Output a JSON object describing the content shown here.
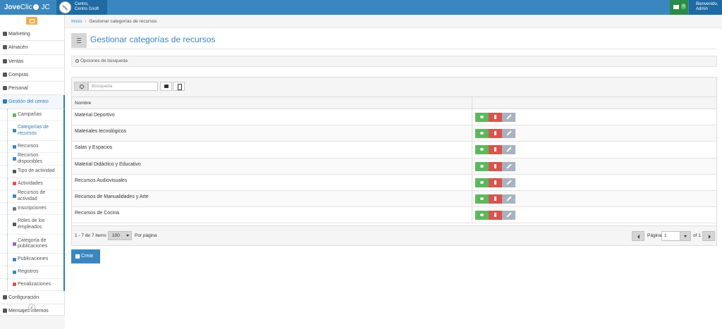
{
  "brand": {
    "logo": "JoveClic",
    "logo_bold": "Jove",
    "logo_light": "Clic",
    "logo_suffix": "JC",
    "color": "#3a87c0"
  },
  "center": {
    "line1": "Centro,",
    "line2": "Centro Gsoft"
  },
  "mail": {
    "badge": "0"
  },
  "user": {
    "line1": "Bienvenido,",
    "line2": "Admin"
  },
  "sidebar": {
    "items_top": [
      {
        "label": "Marketing",
        "icon": "bullhorn-icon"
      },
      {
        "label": "Almacén",
        "icon": "inbox-icon"
      },
      {
        "label": "Ventas",
        "icon": "truck-icon"
      },
      {
        "label": "Compras",
        "icon": "tag-icon"
      },
      {
        "label": "Personal",
        "icon": "graduation-cap-icon"
      },
      {
        "label": "Gestión del centro",
        "icon": "building-icon"
      }
    ],
    "sub_items": [
      {
        "label": "Campañas",
        "icon": "bullhorn-icon",
        "color": "#5cb85c"
      },
      {
        "label": "Categorías de recursos",
        "icon": "tags-icon",
        "color": "#3a87c0"
      },
      {
        "label": "Recursos",
        "icon": "tag-icon",
        "color": "#3a87c0"
      },
      {
        "label": "Recursos disponibles",
        "icon": "tag-icon",
        "color": "#3a87c0"
      },
      {
        "label": "Tipo de actividad",
        "icon": "sitemap-icon",
        "color": "#555555"
      },
      {
        "label": "Actividades",
        "icon": "graduation-cap-icon",
        "color": "#d9534f"
      },
      {
        "label": "Recursos de actividad",
        "icon": "copy-icon",
        "color": "#3a87c0"
      },
      {
        "label": "Inscripciones",
        "icon": "calendar-icon",
        "color": "#777777"
      },
      {
        "label": "Roles de los empleados",
        "icon": "envelope-icon",
        "color": "#555555"
      },
      {
        "label": "Categoría de publicaciones",
        "icon": "tags-icon",
        "color": "#a05fc9"
      },
      {
        "label": "Publicaciones",
        "icon": "edit-icon",
        "color": "#3a87c0"
      },
      {
        "label": "Registros",
        "icon": "users-icon",
        "color": "#3a87c0"
      },
      {
        "label": "Penalizaciones",
        "icon": "lock-icon",
        "color": "#d9534f"
      }
    ],
    "items_bottom": [
      {
        "label": "Configuración",
        "icon": "gear-icon"
      },
      {
        "label": "Mensajes internos",
        "icon": "envelope-icon"
      }
    ]
  },
  "breadcrumb": {
    "home": "Inicio",
    "current": "Gestionar categorías de recursos"
  },
  "page": {
    "title": "Gestionar categorías de recursos"
  },
  "search_panel": {
    "label": "Opciones de búsqueda"
  },
  "grid": {
    "search_placeholder": "Búsqueda",
    "columns": [
      "Nombre",
      ""
    ],
    "rows": [
      "Material Deportivo",
      "Materiales tecnológicos",
      "Salas y Espacios",
      "Material Didáctico y Educativo",
      "Recursos Audiovisuales",
      "Recursos de Manualidades y Arte",
      "Recursos de Cocina"
    ],
    "pager": {
      "info": "1 - 7 de 7 items",
      "page_size": "100",
      "per_page_label": "Por página",
      "page_label": "Página",
      "page": "1",
      "of_label": "of 1"
    }
  },
  "create_button": "Crear",
  "colors": {
    "view": "#5cb85c",
    "delete": "#d9534f",
    "edit": "#a8b3bf",
    "accent": "#3a87c0",
    "warning": "#f0ad4e"
  }
}
